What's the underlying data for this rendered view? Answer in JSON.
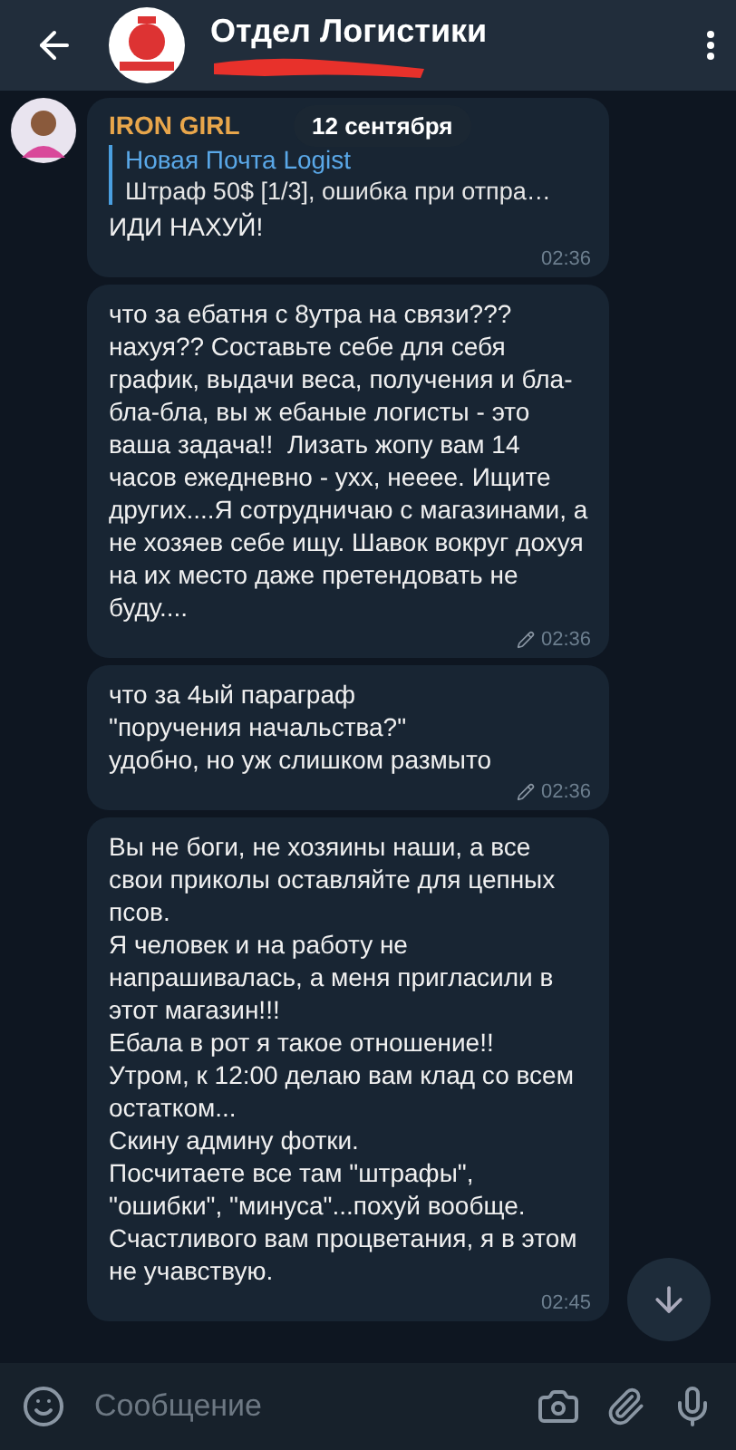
{
  "header": {
    "title": "Отдел Логистики"
  },
  "date_pill": "12 сентября",
  "messages": [
    {
      "sender": "IRON GIRL",
      "reply": {
        "author": "Новая Почта Logist",
        "text": "Штраф 50$ [1/3], ошибка при отпра…"
      },
      "text": "ИДИ НАХУЙ!",
      "time": "02:36",
      "edited": false
    },
    {
      "text": "что за ебатня с 8утра на связи??? нахуя?? Составьте себе для себя график, выдачи веса, получения и бла-бла-бла, вы ж ебаные логисты - это ваша задача!!  Лизать жопу вам 14 часов ежедневно - ухх, неeee. Ищите других....Я сотрудничаю с магазинами, а не хозяев себе ищу. Шавок вокруг дохуя на их место даже претендовать не буду....",
      "time": "02:36",
      "edited": true
    },
    {
      "text": "что за 4ый параграф\n\"поручения начальства?\"\nудобно, но уж слишком размыто",
      "time": "02:36",
      "edited": true
    },
    {
      "text": "Вы не боги, не хозяины наши, а все свои приколы оставляйте для цепных псов.\nЯ человек и на работу не напрашивалась, а меня пригласили в этот магазин!!!\nЕбала в рот я такое отношение!!\nУтром, к 12:00 делаю вам клад со всем остатком...\nСкину админу фотки.\nПосчитаете все там \"штрафы\", \"ошибки\", \"минуса\"...похуй вообще.\nСчастливого вам процветания, я в этом не учавствую.",
      "time": "02:45",
      "edited": false
    }
  ],
  "composer": {
    "placeholder": "Сообщение"
  }
}
